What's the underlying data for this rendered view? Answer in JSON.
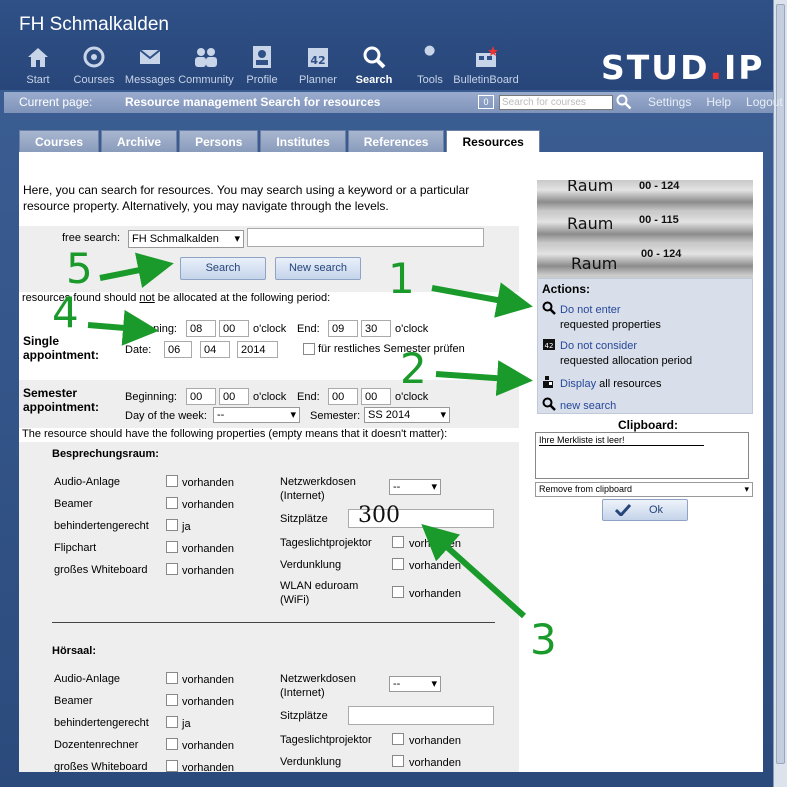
{
  "app": {
    "title": "FH Schmalkalden",
    "logo_main": "STUD",
    "logo_dot": ".",
    "logo_end": "IP"
  },
  "nav": [
    {
      "label": "Start",
      "icon": "home-icon"
    },
    {
      "label": "Courses",
      "icon": "courses-icon"
    },
    {
      "label": "Messages",
      "icon": "mail-icon"
    },
    {
      "label": "Community",
      "icon": "people-icon"
    },
    {
      "label": "Profile",
      "icon": "profile-icon"
    },
    {
      "label": "Planner",
      "icon": "calendar-icon",
      "badge": "42"
    },
    {
      "label": "Search",
      "icon": "search-icon",
      "active": true
    },
    {
      "label": "Tools",
      "icon": "wrench-icon"
    },
    {
      "label": "BulletinBoard",
      "icon": "bulletin-icon"
    }
  ],
  "crumb": {
    "label": "Current page:",
    "current": "Resource management Search for resources",
    "badge": "0",
    "quicksearch_placeholder": "Search for courses",
    "links": [
      "Settings",
      "Help",
      "Logout"
    ]
  },
  "tabs": [
    {
      "label": "Courses"
    },
    {
      "label": "Archive"
    },
    {
      "label": "Persons"
    },
    {
      "label": "Institutes"
    },
    {
      "label": "References"
    },
    {
      "label": "Resources",
      "active": true
    }
  ],
  "intro": "Here, you can search for resources. You may search using a keyword or a particular resource property. Alternatively, you may navigate through the levels.",
  "free_search": {
    "label": "free search:",
    "scope": "FH Schmalkalden",
    "value": "",
    "search_button": "Search",
    "new_search_button": "New search"
  },
  "period_text_pre": "resources found should ",
  "period_text_not": "not",
  "period_text_post": " be allocated at the following period:",
  "single": {
    "title_1": "Single",
    "title_2": "appointment:",
    "beginning_label": "Beginning:",
    "begin_h": "08",
    "begin_m": "00",
    "oclock": "o'clock",
    "end_label": "End:",
    "end_h": "09",
    "end_m": "30",
    "date_label": "Date:",
    "day": "06",
    "month": "04",
    "year": "2014",
    "check_label": "für restliches Semester prüfen"
  },
  "semester": {
    "title_1": "Semester",
    "title_2": "appointment:",
    "beginning_label": "Beginning:",
    "begin_h": "00",
    "begin_m": "00",
    "oclock": "o'clock",
    "end_label": "End:",
    "end_h": "00",
    "end_m": "00",
    "weekday_label": "Day of the week:",
    "weekday": "--",
    "semester_label": "Semester:",
    "semester_value": "SS 2014"
  },
  "properties_intro": "The resource should have the following properties (empty means that it doesn't matter):",
  "groups": [
    {
      "title": "Besprechungsraum:",
      "left": [
        {
          "label": "Audio-Anlage",
          "opt": "vorhanden"
        },
        {
          "label": "Beamer",
          "opt": "vorhanden"
        },
        {
          "label": "behindertengerecht",
          "opt": "ja"
        },
        {
          "label": "Flipchart",
          "opt": "vorhanden"
        },
        {
          "label": "großes Whiteboard",
          "opt": "vorhanden"
        }
      ],
      "netz_1": "Netzwerkdosen",
      "netz_2": "(Internet)",
      "netz_value": "--",
      "sitz": "Sitzplätze",
      "sitz_value": "",
      "right": [
        {
          "label": "Tageslichtprojektor",
          "opt": "vorhanden"
        },
        {
          "label": "Verdunklung",
          "opt": "vorhanden"
        }
      ],
      "wlan_1": "WLAN eduroam",
      "wlan_2": "(WiFi)",
      "wlan_opt": "vorhanden"
    },
    {
      "title": "Hörsaal:",
      "left": [
        {
          "label": "Audio-Anlage",
          "opt": "vorhanden"
        },
        {
          "label": "Beamer",
          "opt": "vorhanden"
        },
        {
          "label": "behindertengerecht",
          "opt": "ja"
        },
        {
          "label": "Dozentenrechner",
          "opt": "vorhanden"
        },
        {
          "label": "großes Whiteboard",
          "opt": "vorhanden"
        }
      ],
      "netz_1": "Netzwerkdosen",
      "netz_2": "(Internet)",
      "netz_value": "--",
      "sitz": "Sitzplätze",
      "sitz_value": "",
      "right": [
        {
          "label": "Tageslichtprojektor",
          "opt": "vorhanden"
        },
        {
          "label": "Verdunklung",
          "opt": "vorhanden"
        }
      ]
    }
  ],
  "sidebar": {
    "raum": [
      "Raum",
      "Raum",
      "Raum"
    ],
    "nums": [
      "00 - 124",
      "00 - 115",
      "00 - 124"
    ],
    "actions_title": "Actions:",
    "act1_link": "Do not enter",
    "act1_rest": "requested properties",
    "act2_link": "Do not consider",
    "act2_rest": "requested allocation period",
    "act3_link": "Display",
    "act3_rest": " all resources",
    "act4_link": "new search",
    "clipboard_title": "Clipboard:",
    "clipboard_text": "Ihre Merkliste ist leer!",
    "clipboard_select": "Remove from clipboard",
    "ok": "Ok"
  },
  "annotations": {
    "n1": "1",
    "n2": "2",
    "n3": "3",
    "n4": "4",
    "n5": "5",
    "seats": "300",
    "color": "#1a9a2a"
  }
}
